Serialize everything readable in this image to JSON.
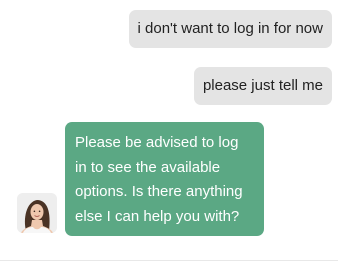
{
  "messages": [
    {
      "sender": "user",
      "text": "i don't want to log in for now"
    },
    {
      "sender": "user",
      "text": "please just tell me"
    },
    {
      "sender": "agent",
      "text": "Please be advised to log in to see the available options. Is there anything else I can help you with?"
    }
  ],
  "colors": {
    "user_bubble": "#e4e4e4",
    "agent_bubble": "#5ba884",
    "agent_text": "#ffffff"
  },
  "agent": {
    "avatar_icon": "agent-avatar-photo"
  }
}
